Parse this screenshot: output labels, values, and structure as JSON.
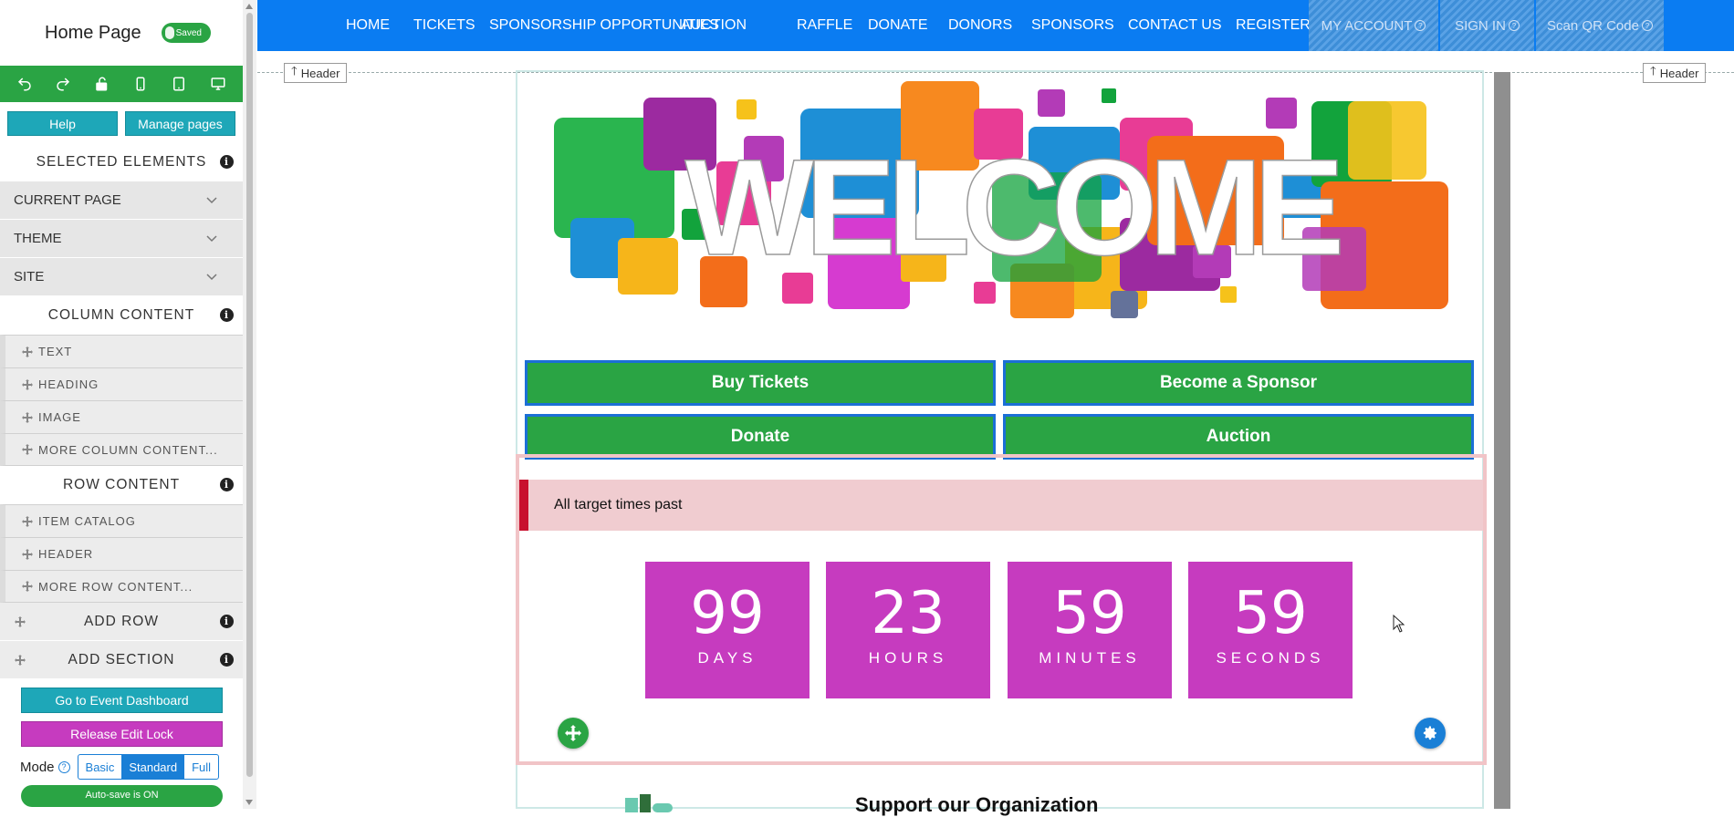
{
  "sidebar": {
    "page_name": "Home Page",
    "saved_label": "Saved",
    "toolbar_icons": [
      "undo-icon",
      "redo-icon",
      "unlock-icon",
      "phone-icon",
      "tablet-icon",
      "desktop-icon"
    ],
    "help_label": "Help",
    "manage_pages_label": "Manage pages",
    "selected_elements": "SELECTED ELEMENTS",
    "accordions": [
      "CURRENT PAGE",
      "THEME",
      "SITE"
    ],
    "column_content": "COLUMN CONTENT",
    "column_items": [
      "TEXT",
      "HEADING",
      "IMAGE",
      "MORE COLUMN CONTENT..."
    ],
    "row_content": "ROW CONTENT",
    "row_items": [
      "ITEM CATALOG",
      "HEADER",
      "MORE ROW CONTENT..."
    ],
    "add_row": "ADD ROW",
    "add_section": "ADD SECTION",
    "dashboard_label": "Go to Event Dashboard",
    "release_lock_label": "Release Edit Lock",
    "mode_label": "Mode",
    "modes": [
      "Basic",
      "Standard",
      "Full"
    ],
    "active_mode": "Standard",
    "autosave_label": "Auto-save is ON",
    "colors": {
      "green": "#2aa444",
      "teal": "#1ea7b8",
      "magenta": "#c63bbf"
    }
  },
  "nav": {
    "items": [
      "HOME",
      "TICKETS",
      "SPONSORSHIP OPPORTUNITIES",
      "AUCTION",
      "RAFFLE",
      "DONATE",
      "DONORS",
      "SPONSORS",
      "CONTACT US",
      "REGISTER"
    ],
    "hidden_items": [
      "MY ACCOUNT",
      "SIGN IN",
      "Scan QR Code"
    ],
    "color": "#0a7cf2"
  },
  "canvas": {
    "header_tag": "Header",
    "banner_text": "WELCOME",
    "cta_buttons": [
      "Buy Tickets",
      "Become a Sponsor",
      "Donate",
      "Auction"
    ],
    "alert_text": "All target times past",
    "countdown": [
      {
        "value": "99",
        "label": "DAYS"
      },
      {
        "value": "23",
        "label": "HOURS"
      },
      {
        "value": "59",
        "label": "MINUTES"
      },
      {
        "value": "59",
        "label": "SECONDS"
      }
    ],
    "support_title": "Support our Organization"
  }
}
